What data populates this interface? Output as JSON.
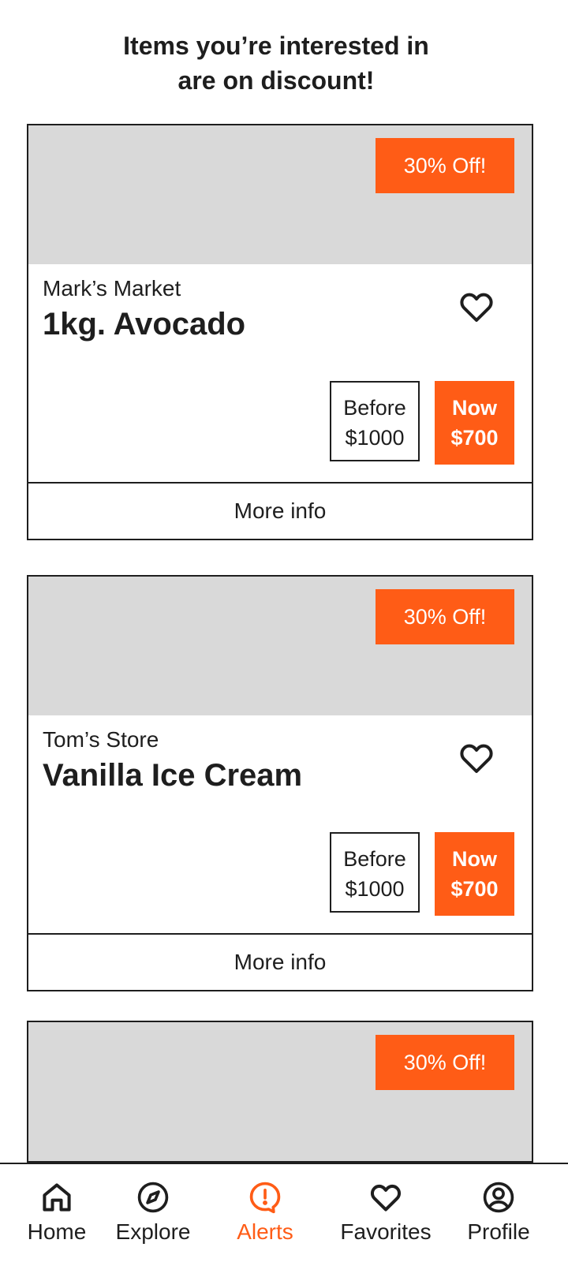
{
  "header": {
    "title_line1": "Items you’re interested in",
    "title_line2": "are on discount!"
  },
  "colors": {
    "accent": "#ff5c16",
    "image_placeholder": "#d9d9d9",
    "text": "#1e1e1e"
  },
  "cards": [
    {
      "badge": "30% Off!",
      "store": "Mark’s Market",
      "product": "1kg. Avocado",
      "before_label": "Before",
      "before_price": "$1000",
      "now_label": "Now",
      "now_price": "$700",
      "more_info": "More info"
    },
    {
      "badge": "30% Off!",
      "store": "Tom’s Store",
      "product": "Vanilla Ice Cream",
      "before_label": "Before",
      "before_price": "$1000",
      "now_label": "Now",
      "now_price": "$700",
      "more_info": "More info"
    },
    {
      "badge": "30% Off!"
    }
  ],
  "nav": {
    "active": "Alerts",
    "items": [
      {
        "label": "Home",
        "icon": "home-icon"
      },
      {
        "label": "Explore",
        "icon": "compass-icon"
      },
      {
        "label": "Alerts",
        "icon": "alert-bubble-icon"
      },
      {
        "label": "Favorites",
        "icon": "heart-icon"
      },
      {
        "label": "Profile",
        "icon": "user-circle-icon"
      }
    ]
  }
}
